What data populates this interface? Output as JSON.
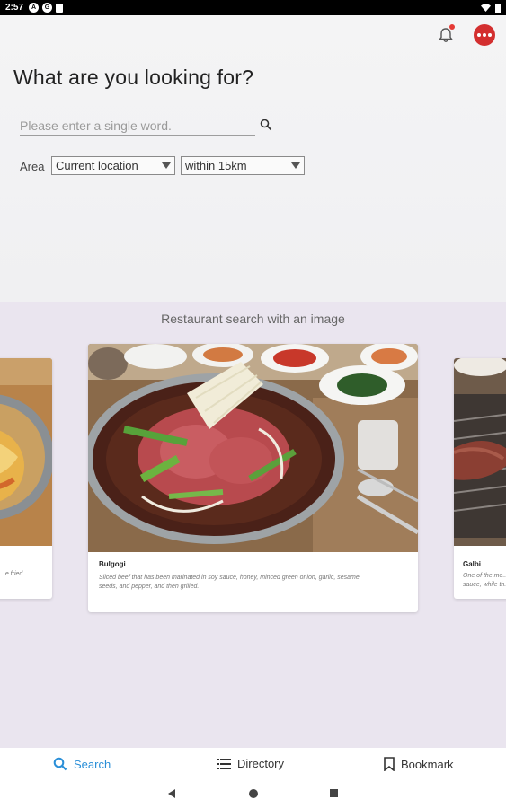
{
  "status_bar": {
    "time": "2:57",
    "icon_a": "A",
    "icon_b": "G"
  },
  "header": {
    "title": "What are you looking for?",
    "search_placeholder": "Please enter a single word.",
    "area_label": "Area",
    "location_select": "Current location",
    "distance_select": "within 15km"
  },
  "image_search": {
    "title": "Restaurant search with an image",
    "cards": [
      {
        "name": "",
        "desc": "...e fried"
      },
      {
        "name": "Bulgogi",
        "desc_line1": "Sliced beef that has been marinated in soy sauce, honey, minced green onion, garlic, sesame",
        "desc_line2": "seeds, and pepper, and then grilled."
      },
      {
        "name": "Galbi",
        "desc_line1": "One of the mo...",
        "desc_line2": "sauce, while th..."
      }
    ]
  },
  "bottom_nav": {
    "search": "Search",
    "directory": "Directory",
    "bookmark": "Bookmark",
    "active_color": "#2a8fd8"
  }
}
